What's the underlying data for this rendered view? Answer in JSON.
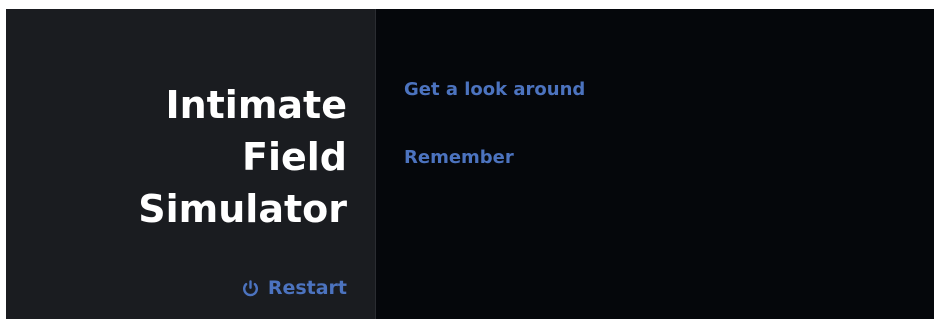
{
  "sidebar": {
    "title_lines": [
      "Intimate",
      "Field",
      "Simulator"
    ],
    "restart_label": "Restart",
    "restart_icon": "power-icon"
  },
  "main": {
    "options": [
      {
        "label": "Get a look around"
      },
      {
        "label": "Remember"
      }
    ]
  },
  "colors": {
    "sidebar_bg": "#1a1c20",
    "main_bg": "#05070b",
    "link": "#4c73bf",
    "title": "#ffffff"
  }
}
